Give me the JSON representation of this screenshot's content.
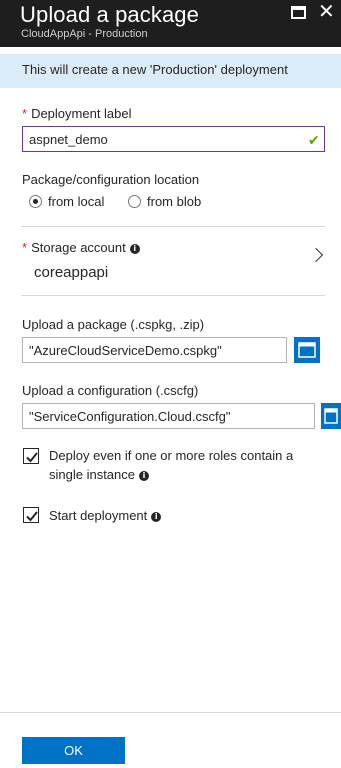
{
  "header": {
    "title": "Upload a package",
    "subtitle": "CloudAppApi - Production"
  },
  "banner": {
    "text": "This will create a new 'Production' deployment"
  },
  "deployment_label": {
    "label": "Deployment label",
    "value": "aspnet_demo"
  },
  "location": {
    "label": "Package/configuration location",
    "options": [
      "from local",
      "from blob"
    ],
    "selected": "from local"
  },
  "storage": {
    "label": "Storage account",
    "value": "coreappapi"
  },
  "package": {
    "label": "Upload a package (.cspkg, .zip)",
    "value": "\"AzureCloudServiceDemo.cspkg\""
  },
  "configuration": {
    "label": "Upload a configuration (.cscfg)",
    "value": "\"ServiceConfiguration.Cloud.cscfg\""
  },
  "deploy_single": {
    "label_line1": "Deploy even if one or more roles contain a",
    "label_line2": "single instance",
    "checked": true
  },
  "start_deployment": {
    "label": "Start deployment",
    "checked": true
  },
  "footer": {
    "ok_label": "OK"
  },
  "colors": {
    "accent": "#0072c6",
    "header_bg": "#1e1e1e",
    "banner_bg": "#dcebf8",
    "required": "#c8322d",
    "valid": "#57a300"
  }
}
